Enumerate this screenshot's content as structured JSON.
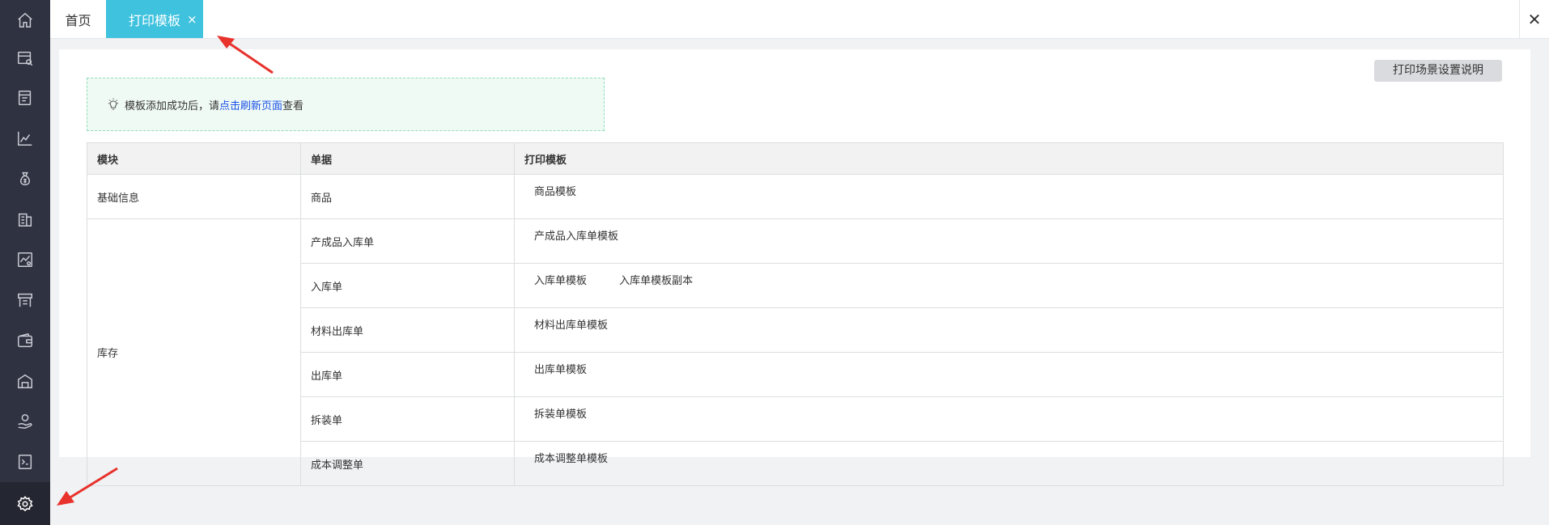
{
  "sidebar": {
    "items": [
      {
        "icon": "home-icon"
      },
      {
        "icon": "purchase-search-icon"
      },
      {
        "icon": "sales-order-icon"
      },
      {
        "icon": "chart-icon"
      },
      {
        "icon": "money-bag-icon"
      },
      {
        "icon": "building-icon"
      },
      {
        "icon": "report-icon"
      },
      {
        "icon": "store-icon"
      },
      {
        "icon": "wallet-icon"
      },
      {
        "icon": "warehouse-icon"
      },
      {
        "icon": "hand-coin-icon"
      },
      {
        "icon": "document-icon"
      },
      {
        "icon": "gear-icon",
        "active": true
      }
    ]
  },
  "tabs": {
    "home_label": "首页",
    "active_label": "打印模板",
    "close_symbol": "×"
  },
  "topbar": {
    "close_symbol": "✕"
  },
  "content": {
    "help_button": "打印场景设置说明",
    "tip": {
      "prefix": "模板添加成功后，请",
      "link": "点击刷新页面",
      "suffix": "查看"
    },
    "table": {
      "headers": {
        "module": "模块",
        "document": "单据",
        "template": "打印模板"
      },
      "groups": [
        {
          "module": "基础信息",
          "rows": [
            {
              "document": "商品",
              "templates": [
                "商品模板"
              ]
            }
          ]
        },
        {
          "module": "库存",
          "rows": [
            {
              "document": "产成品入库单",
              "templates": [
                "产成品入库单模板"
              ]
            },
            {
              "document": "入库单",
              "templates": [
                "入库单模板",
                "入库单模板副本"
              ]
            },
            {
              "document": "材料出库单",
              "templates": [
                "材料出库单模板"
              ]
            },
            {
              "document": "出库单",
              "templates": [
                "出库单模板"
              ]
            },
            {
              "document": "拆装单",
              "templates": [
                "拆装单模板"
              ]
            },
            {
              "document": "成本调整单",
              "templates": [
                "成本调整单模板"
              ]
            }
          ]
        }
      ]
    }
  },
  "colors": {
    "sidebar_bg": "#2f3240",
    "active_tab": "#3fc2de",
    "annotation_arrow": "#e8322c",
    "link": "#1a51e8"
  }
}
